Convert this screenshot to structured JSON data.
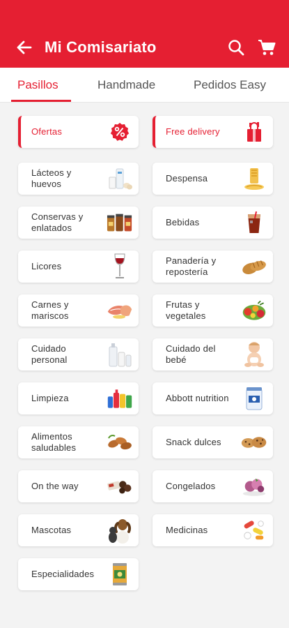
{
  "app_bar": {
    "title": "Mi Comisariato"
  },
  "tabs": [
    {
      "label": "Pasillos",
      "active": true
    },
    {
      "label": "Handmade",
      "active": false
    },
    {
      "label": "Pedidos Easy",
      "active": false
    }
  ],
  "categories": [
    {
      "label": "Ofertas",
      "icon": "percent-badge-icon",
      "promo": true
    },
    {
      "label": "Free delivery",
      "icon": "gift-bag-icon",
      "promo": true
    },
    {
      "label": "Lácteos y huevos",
      "icon": "dairy-eggs-icon"
    },
    {
      "label": "Despensa",
      "icon": "pasta-icon"
    },
    {
      "label": "Conservas y enlatados",
      "icon": "canned-jars-icon"
    },
    {
      "label": "Bebidas",
      "icon": "soda-glass-icon"
    },
    {
      "label": "Licores",
      "icon": "wine-glass-icon"
    },
    {
      "label": "Panadería y repostería",
      "icon": "bread-icon"
    },
    {
      "label": "Carnes y mariscos",
      "icon": "meat-seafood-icon"
    },
    {
      "label": "Frutas y vegetales",
      "icon": "fruits-vegetables-icon"
    },
    {
      "label": "Cuidado personal",
      "icon": "personal-care-bottles-icon"
    },
    {
      "label": "Cuidado del bebé",
      "icon": "baby-icon"
    },
    {
      "label": "Limpieza",
      "icon": "cleaning-products-icon"
    },
    {
      "label": "Abbott nutrition",
      "icon": "formula-can-icon"
    },
    {
      "label": "Alimentos saludables",
      "icon": "almonds-icon"
    },
    {
      "label": "Snack dulces",
      "icon": "cookies-icon"
    },
    {
      "label": "On the way",
      "icon": "chocolate-icon"
    },
    {
      "label": "Congelados",
      "icon": "frozen-dessert-icon"
    },
    {
      "label": "Mascotas",
      "icon": "dog-cat-icon"
    },
    {
      "label": "Medicinas",
      "icon": "pills-icon"
    },
    {
      "label": "Especialidades",
      "icon": "specialty-can-icon"
    }
  ],
  "colors": {
    "brand": "#e51f32",
    "background": "#f3f3f3",
    "card": "#ffffff"
  }
}
